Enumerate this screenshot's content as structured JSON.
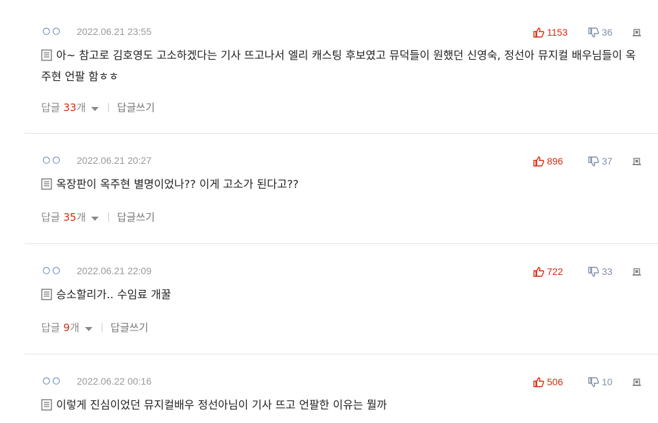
{
  "comments": [
    {
      "nick": "○○",
      "date": "2022.06.21 23:55",
      "likes": "1153",
      "dislikes": "36",
      "text": "아~ 참고로 김호영도 고소하겠다는 기사 뜨고나서 엘리 캐스팅 후보였고 뮤덕들이 원했던 신영숙, 정선아 뮤지컬 배우님들이 옥주현 언팔 함ㅎㅎ",
      "reply_label": "답글",
      "reply_count": "33",
      "reply_unit": "개",
      "write_label": "답글쓰기"
    },
    {
      "nick": "○○",
      "date": "2022.06.21 20:27",
      "likes": "896",
      "dislikes": "37",
      "text": "옥장판이 옥주현 별명이었나?? 이게 고소가 된다고??",
      "reply_label": "답글",
      "reply_count": "35",
      "reply_unit": "개",
      "write_label": "답글쓰기"
    },
    {
      "nick": "○○",
      "date": "2022.06.21 22:09",
      "likes": "722",
      "dislikes": "33",
      "text": "승소할리가.. 수임료 개꿀",
      "reply_label": "답글",
      "reply_count": "9",
      "reply_unit": "개",
      "write_label": "답글쓰기"
    },
    {
      "nick": "○○",
      "date": "2022.06.22 00:16",
      "likes": "506",
      "dislikes": "10",
      "text": "이렇게 진심이었던 뮤지컬배우 정선아님이 기사 뜨고 언팔한 이유는 뭘까"
    }
  ],
  "icons": {
    "like": "thumbs-up-icon",
    "dislike": "thumbs-down-icon",
    "report": "report-icon",
    "doc": "document-icon",
    "caret": "caret-down-icon"
  },
  "colors": {
    "like": "#d9280f",
    "dislike": "#8090a8",
    "nick": "#3a5ea8",
    "reply_count": "#d9280f"
  }
}
